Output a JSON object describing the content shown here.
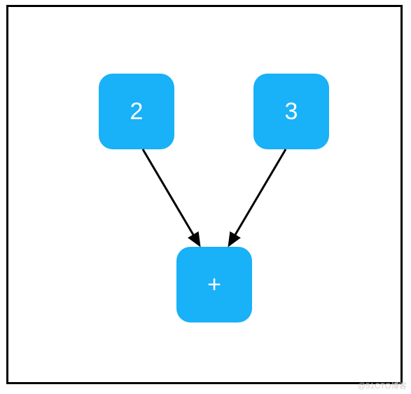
{
  "diagram": {
    "nodes": {
      "left": {
        "label": "2"
      },
      "right": {
        "label": "3"
      },
      "bottom": {
        "label": "+"
      }
    },
    "edges": [
      {
        "from": "left",
        "to": "bottom"
      },
      {
        "from": "right",
        "to": "bottom"
      }
    ],
    "node_color": "#19B1F7",
    "text_color": "#ffffff"
  },
  "watermark": "@51CTO博客"
}
